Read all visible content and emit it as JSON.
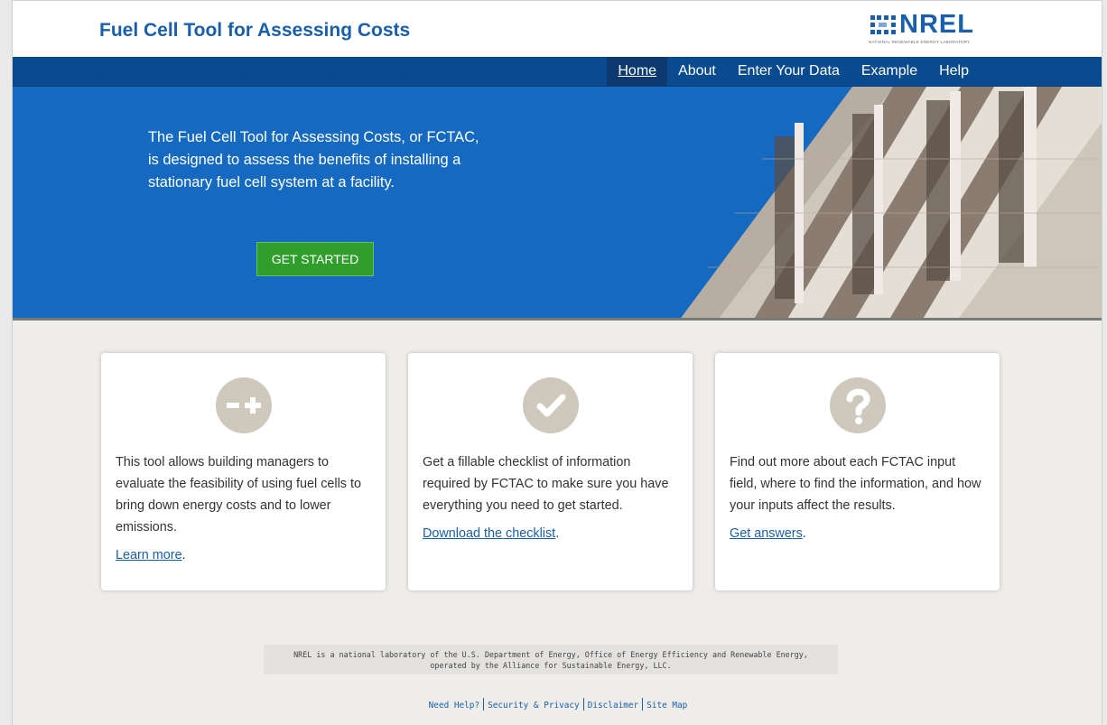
{
  "header": {
    "title": "Fuel Cell Tool for Assessing Costs",
    "logo_text": "NREL",
    "logo_subtitle": "NATIONAL RENEWABLE ENERGY LABORATORY"
  },
  "nav": {
    "items": [
      "Home",
      "About",
      "Enter Your Data",
      "Example",
      "Help"
    ],
    "active": "Home"
  },
  "hero": {
    "text": "The Fuel Cell Tool for Assessing Costs, or FCTAC, is designed to assess the benefits of installing a stationary fuel cell system at a facility.",
    "button": "GET STARTED"
  },
  "cards": [
    {
      "icon": "minus-plus-icon",
      "text": "This tool allows building managers to evaluate the feasibility of using fuel cells to bring down energy costs and to lower emissions.",
      "link": "Learn more",
      "after": "."
    },
    {
      "icon": "checkmark-icon",
      "text": "Get a fillable checklist of information required by FCTAC to make sure you have everything you need to get started.",
      "link": "Download the checklist",
      "after": "."
    },
    {
      "icon": "question-icon",
      "text": "Find out more about each FCTAC input field, where to find the information, and how your inputs affect the results.",
      "link": "Get answers",
      "after": "."
    }
  ],
  "footer": {
    "notice_line1": "NREL is a national laboratory of the U.S. Department of Energy, Office of Energy Efficiency and Renewable Energy,",
    "notice_line2": "operated by the Alliance for Sustainable Energy, LLC.",
    "links": [
      "Need Help?",
      "Security & Privacy",
      "Disclaimer",
      "Site Map"
    ]
  },
  "colors": {
    "brand_blue": "#1a5faa",
    "nav_blue": "#0a4a8e",
    "hero_blue": "#1669c0",
    "cta_green": "#2f9e2b",
    "icon_taupe": "#cfc8bc"
  }
}
